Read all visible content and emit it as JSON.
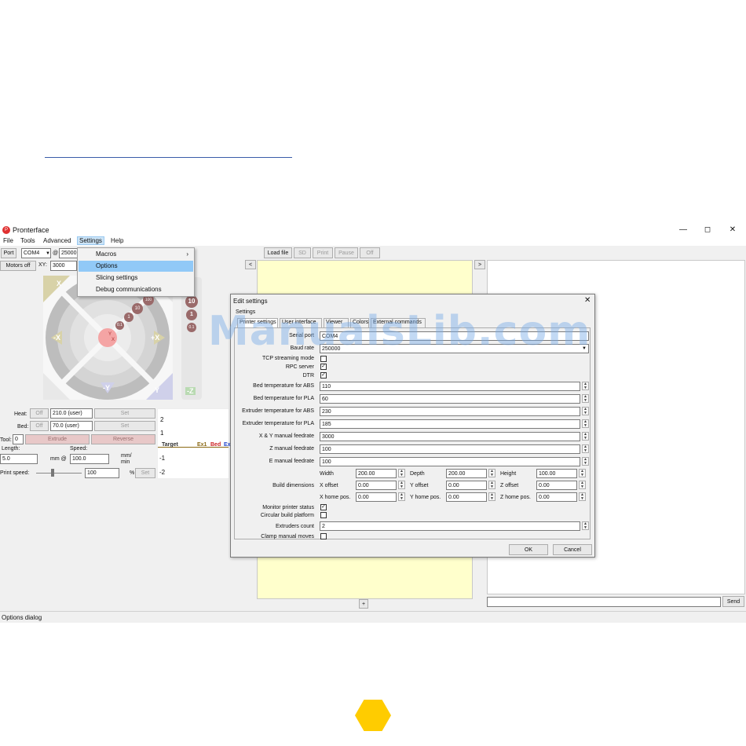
{
  "window": {
    "title": "Pronterface",
    "icon_text": "P",
    "minimize": "—",
    "maximize": "◻",
    "close": "✕"
  },
  "menubar": {
    "items": [
      "File",
      "Tools",
      "Advanced",
      "Settings",
      "Help"
    ]
  },
  "settings_menu": {
    "items": [
      {
        "label": "Macros",
        "arrow": "›"
      },
      {
        "label": "Options",
        "selected": true
      },
      {
        "label": "Slicing settings"
      },
      {
        "label": "Debug communications"
      }
    ]
  },
  "toolbar": {
    "port_label": "Port",
    "port_value": "COM4",
    "at_label": "@",
    "baud_value": "25000",
    "load_file": "Load file",
    "sd": "SD",
    "print": "Print",
    "pause": "Pause",
    "off": "Off"
  },
  "controls": {
    "motors_off": "Motors off",
    "xy_label": "XY:",
    "xy_feed": "3000",
    "home_x": "X",
    "home_y": "Y",
    "minus_x": "-X",
    "plus_x": "+X",
    "minus_y": "-Y",
    "plus_y": "+Y",
    "center_y": "Y",
    "center_x": "X",
    "minus_z": "-Z",
    "steps": [
      "100",
      "10",
      "1",
      "0.1"
    ],
    "z_steps": [
      "10",
      "1",
      "0.1"
    ]
  },
  "temps": {
    "heat_label": "Heat:",
    "bed_label": "Bed:",
    "off": "Off",
    "heat_value": "210.0 (user)",
    "bed_value": "70.0 (user)",
    "set": "Set",
    "tool_label": "Tool:",
    "tool_value": "0",
    "extrude": "Extrude",
    "reverse": "Reverse",
    "length_label": "Length:",
    "speed_label": "Speed:",
    "length_value": "5.0",
    "mm_at": "mm @",
    "speed_value": "100.0",
    "mm_min": "mm/\nmin",
    "print_speed_label": "Print speed:",
    "print_speed_value": "100",
    "percent": "%",
    "set2": "Set"
  },
  "graph": {
    "ticks": [
      "2",
      "1",
      "-1",
      "-2"
    ],
    "legend_target": "Target",
    "legend_ex1": "Ex1",
    "legend_bed": "Bed",
    "legend_ex": "Ex",
    "colors": {
      "target": "#333333",
      "ex1": "#8b6914",
      "bed": "#cc2222",
      "ex": "#2244cc"
    }
  },
  "panels": {
    "left_arrow": "<",
    "right_arrow": ">",
    "plus": "+",
    "send": "Send"
  },
  "dialog": {
    "title": "Edit settings",
    "close": "✕",
    "group": "Settings",
    "tabs": [
      "Printer settings",
      "User interface",
      "Viewer",
      "Colors",
      "External commands"
    ],
    "ok": "OK",
    "cancel": "Cancel",
    "rows": {
      "serial_port": {
        "label": "Serial port",
        "value": "COM4"
      },
      "baud_rate": {
        "label": "Baud rate",
        "value": "250000"
      },
      "tcp": {
        "label": "TCP streaming mode"
      },
      "rpc": {
        "label": "RPC server",
        "check": "✓"
      },
      "dtr": {
        "label": "DTR",
        "check": "✓"
      },
      "bed_abs": {
        "label": "Bed temperature for ABS",
        "value": "110"
      },
      "bed_pla": {
        "label": "Bed temperature for PLA",
        "value": "60"
      },
      "ext_abs": {
        "label": "Extruder temperature for ABS",
        "value": "230"
      },
      "ext_pla": {
        "label": "Extruder temperature for PLA",
        "value": "185"
      },
      "xy_feed": {
        "label": "X & Y manual feedrate",
        "value": "3000"
      },
      "z_feed": {
        "label": "Z manual feedrate",
        "value": "100"
      },
      "e_feed": {
        "label": "E manual feedrate",
        "value": "100"
      },
      "build_dims": {
        "label": "Build dimensions"
      },
      "width": {
        "label": "Width",
        "value": "200.00"
      },
      "depth": {
        "label": "Depth",
        "value": "200.00"
      },
      "height": {
        "label": "Height",
        "value": "100.00"
      },
      "x_offset": {
        "label": "X offset",
        "value": "0.00"
      },
      "y_offset": {
        "label": "Y offset",
        "value": "0.00"
      },
      "z_offset": {
        "label": "Z offset",
        "value": "0.00"
      },
      "x_home": {
        "label": "X home pos.",
        "value": "0.00"
      },
      "y_home": {
        "label": "Y home pos.",
        "value": "0.00"
      },
      "z_home": {
        "label": "Z home pos.",
        "value": "0.00"
      },
      "monitor": {
        "label": "Monitor printer status",
        "check": "✓"
      },
      "circular": {
        "label": "Circular build platform"
      },
      "extruders": {
        "label": "Extruders count",
        "value": "2"
      },
      "clamp": {
        "label": "Clamp manual moves"
      }
    }
  },
  "status": {
    "text": "Options dialog"
  },
  "watermark": {
    "text": "ManualsLib.com"
  },
  "colors": {
    "accent": "#91c9f7",
    "yellow_panel": "#ffffcc",
    "hex_logo": "#ffcc00"
  }
}
